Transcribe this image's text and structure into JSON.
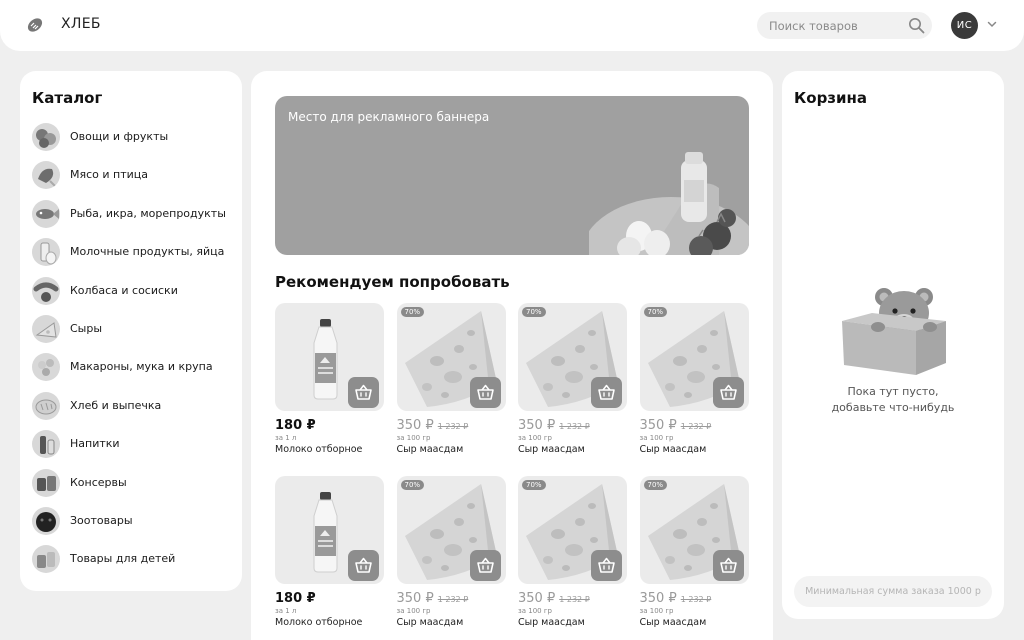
{
  "header": {
    "brand": "ХЛЕБ",
    "search_placeholder": "Поиск товаров",
    "avatar_initials": "ИС"
  },
  "catalog": {
    "title": "Каталог",
    "items": [
      {
        "label": "Овощи и фрукты",
        "icon": "vegetables-icon"
      },
      {
        "label": "Мясо и птица",
        "icon": "meat-icon"
      },
      {
        "label": "Рыба, икра, морепродукты",
        "icon": "fish-icon"
      },
      {
        "label": "Молочные продукты, яйца",
        "icon": "dairy-icon"
      },
      {
        "label": "Колбаса и сосиски",
        "icon": "sausage-icon"
      },
      {
        "label": "Сыры",
        "icon": "cheese-icon"
      },
      {
        "label": "Макароны, мука и крупа",
        "icon": "pasta-icon"
      },
      {
        "label": "Хлеб и выпечка",
        "icon": "bread-icon"
      },
      {
        "label": "Напитки",
        "icon": "drinks-icon"
      },
      {
        "label": "Консервы",
        "icon": "canned-icon"
      },
      {
        "label": "Зоотовары",
        "icon": "pet-icon"
      },
      {
        "label": "Товары для детей",
        "icon": "kids-icon"
      }
    ]
  },
  "banner": {
    "text": "Место для рекламного баннера"
  },
  "recommend": {
    "title": "Рекомендуем попробовать",
    "products": [
      {
        "kind": "milk",
        "price": "180 ₽",
        "unit": "за 1 л",
        "name": "Молоко отборное"
      },
      {
        "kind": "cheese",
        "badge": "70%",
        "price": "350 ₽",
        "old_price": "1 232 ₽",
        "unit": "за 100 гр",
        "name": "Сыр маасдам"
      },
      {
        "kind": "cheese",
        "badge": "70%",
        "price": "350 ₽",
        "old_price": "1 232 ₽",
        "unit": "за 100 гр",
        "name": "Сыр маасдам"
      },
      {
        "kind": "cheese",
        "badge": "70%",
        "price": "350 ₽",
        "old_price": "1 232 ₽",
        "unit": "за 100 гр",
        "name": "Сыр маасдам"
      },
      {
        "kind": "milk",
        "price": "180 ₽",
        "unit": "за 1 л",
        "name": "Молоко отборное"
      },
      {
        "kind": "cheese",
        "badge": "70%",
        "price": "350 ₽",
        "old_price": "1 232 ₽",
        "unit": "за 100 гр",
        "name": "Сыр маасдам"
      },
      {
        "kind": "cheese",
        "badge": "70%",
        "price": "350 ₽",
        "old_price": "1 232 ₽",
        "unit": "за 100 гр",
        "name": "Сыр маасдам"
      },
      {
        "kind": "cheese",
        "badge": "70%",
        "price": "350 ₽",
        "old_price": "1 232 ₽",
        "unit": "за 100 гр",
        "name": "Сыр маасдам"
      }
    ]
  },
  "cart": {
    "title": "Корзина",
    "empty_line1": "Пока тут пусто,",
    "empty_line2": "добавьте что-нибудь",
    "min_order": "Минимальная сумма заказа 1000 р"
  }
}
